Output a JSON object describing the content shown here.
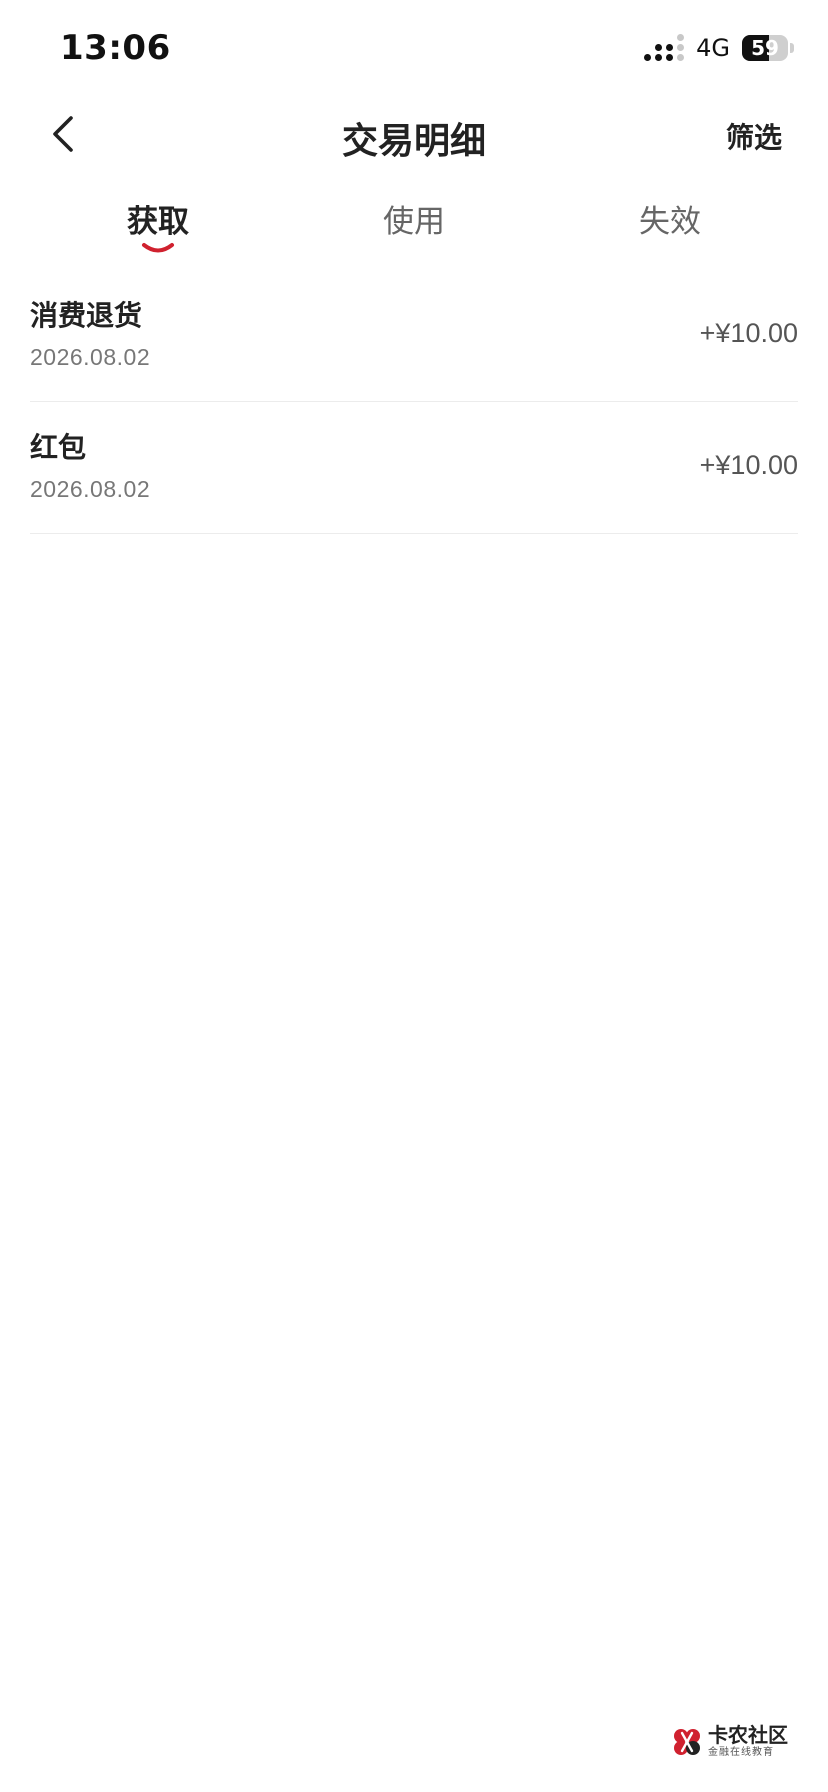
{
  "status_bar": {
    "time": "13:06",
    "network": "4G",
    "battery": "59",
    "battery_level_pct": 59
  },
  "nav": {
    "title": "交易明细",
    "filter_label": "筛选",
    "back_icon": "chevron-left-icon"
  },
  "tabs": [
    {
      "label": "获取",
      "active": true
    },
    {
      "label": "使用",
      "active": false
    },
    {
      "label": "失效",
      "active": false
    }
  ],
  "transactions": [
    {
      "title": "消费退货",
      "date": "2026.08.02",
      "amount": "+¥10.00"
    },
    {
      "title": "红包",
      "date": "2026.08.02",
      "amount": "+¥10.00"
    }
  ],
  "watermark": {
    "main": "卡农社区",
    "sub": "金融在线教育"
  },
  "colors": {
    "accent": "#d0212f",
    "text_primary": "#222222",
    "text_secondary": "#777777",
    "divider": "#ececec"
  }
}
